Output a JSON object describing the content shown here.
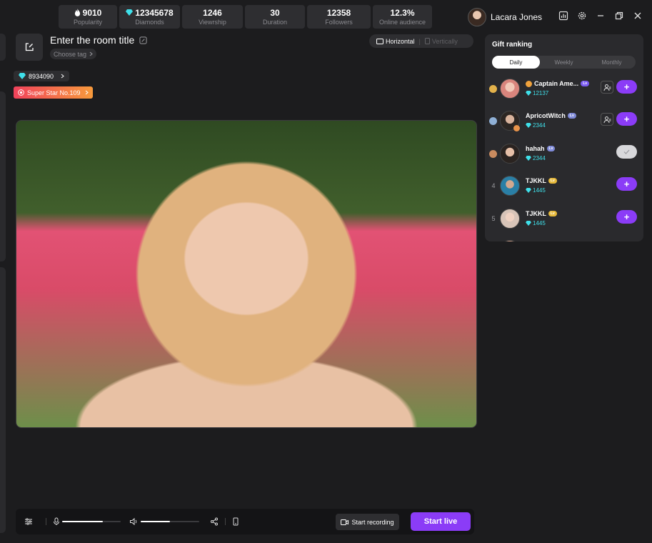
{
  "stats": [
    {
      "value": "9010",
      "label": "Popularity",
      "icon": "flame-icon"
    },
    {
      "value": "12345678",
      "label": "Diamonds",
      "icon": "diamond-icon"
    },
    {
      "value": "1246",
      "label": "Viewrship"
    },
    {
      "value": "30",
      "label": "Duration"
    },
    {
      "value": "12358",
      "label": "Followers"
    },
    {
      "value": "12.3%",
      "label": "Online audience"
    }
  ],
  "user": {
    "name": "Lacara Jones"
  },
  "room": {
    "title": "Enter the room title",
    "tag_label": "Choose tag",
    "orientation": {
      "horizontal": "Horizontal",
      "vertical": "Vertically",
      "selected": "Horizontal"
    },
    "diamonds": "8934090",
    "super_star": "Super Star No.109"
  },
  "controls": {
    "mic_level": 0.7,
    "volume_level": 0.5,
    "record_label": "Start recording",
    "live_label": "Start live"
  },
  "gift_ranking": {
    "title": "Gift ranking",
    "tabs": [
      {
        "label": "Daily",
        "active": true
      },
      {
        "label": "Weekly",
        "active": false
      },
      {
        "label": "Monthly",
        "active": false
      }
    ],
    "entries": [
      {
        "rank": "1",
        "name": "Captain Ame...",
        "points": "12137",
        "action": "add",
        "medal": "gold"
      },
      {
        "rank": "2",
        "name": "ApricotWitch",
        "points": "2344",
        "action": "add",
        "medal": "silver"
      },
      {
        "rank": "3",
        "name": "hahah",
        "points": "2344",
        "action": "done",
        "medal": "bronze"
      },
      {
        "rank": "4",
        "name": "TJKKL",
        "points": "1445",
        "action": "add"
      },
      {
        "rank": "5",
        "name": "TJKKL",
        "points": "1445",
        "action": "add"
      }
    ]
  },
  "colors": {
    "accent": "#8b3cf7",
    "diamond": "#3fe0ea",
    "star_start": "#f0425b",
    "star_end": "#f79a3c"
  }
}
